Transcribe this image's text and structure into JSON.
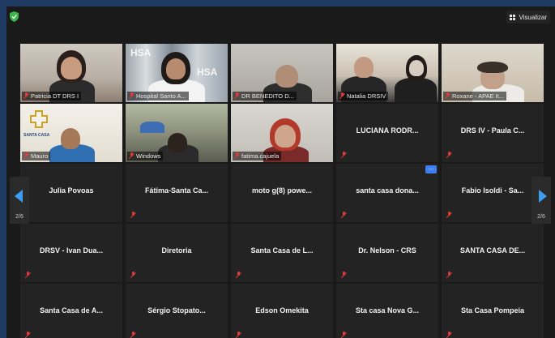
{
  "topbar": {
    "view_label": "Visualizar",
    "colors": {
      "shield": "#3cb54a",
      "accent": "#3d7ff0",
      "muted_mic": "#e03a3a"
    }
  },
  "pagination": {
    "left": "2/6",
    "right": "2/6"
  },
  "video_tiles": [
    {
      "label": "Patricia DT DRS I"
    },
    {
      "label": "Hospital Santo A..."
    },
    {
      "label": "DR BENEDITO D..."
    },
    {
      "label": "Natalia DRSIV"
    },
    {
      "label": "Roxane - APAE It..."
    },
    {
      "label": "Mauro",
      "logo_text": "SANTA CASA"
    },
    {
      "label": "Windows"
    },
    {
      "label": "fatima.cajuela"
    }
  ],
  "hsa_logo_text": "HSA",
  "name_tiles": [
    "LUCIANA RODR...",
    "DRS IV - Paula C...",
    "Julia Povoas",
    "Fátima-Santa  Ca...",
    "moto g(8) powe...",
    "santa casa dona...",
    "Fabio Isoldi - Sa...",
    "DRSV - Ivan Dua...",
    "Diretoria",
    "Santa Casa de L...",
    "Dr. Nelson - CRS",
    "SANTA CASA DE...",
    "Santa Casa de A...",
    "Sérgio  Stopato...",
    "Edson Omekita",
    "Sta casa Nova G...",
    "Sta Casa Pompeia"
  ],
  "more_options": "..."
}
